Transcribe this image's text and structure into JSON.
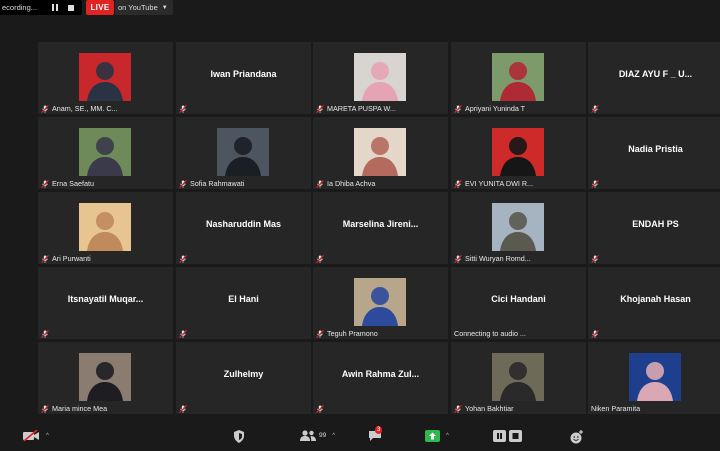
{
  "topbar": {
    "recording_text": "ecording...",
    "live_label": "LIVE",
    "youtube_label": "on YouTube"
  },
  "participants": [
    {
      "name": "Anam, SE., MM. C...",
      "has_video": true,
      "photo_bg": "#c8282c",
      "photo_fg": "#2a3344"
    },
    {
      "name": "",
      "display": "Iwan Priandana",
      "has_video": false
    },
    {
      "name": "MARETA PUSPA W...",
      "has_video": true,
      "photo_bg": "#d8d4cf",
      "photo_fg": "#e6a3b6"
    },
    {
      "name": "Apriyani Yuninda T",
      "has_video": true,
      "photo_bg": "#7d9a6a",
      "photo_fg": "#b02a35"
    },
    {
      "name": "",
      "display": "DIAZ AYU F _ U...",
      "has_video": false
    },
    {
      "name": "Erna Saefatu",
      "has_video": true,
      "photo_bg": "#6d8a58",
      "photo_fg": "#3a3a4a"
    },
    {
      "name": "Sofia Rahmawati",
      "has_video": true,
      "photo_bg": "#4d5660",
      "photo_fg": "#1a1f24"
    },
    {
      "name": "Ia Dhiba Achva",
      "has_video": true,
      "photo_bg": "#e4d6c8",
      "photo_fg": "#b46a5c"
    },
    {
      "name": "EVI YUNITA DWI R...",
      "has_video": true,
      "photo_bg": "#cf2a2a",
      "photo_fg": "#161616"
    },
    {
      "name": "",
      "display": "Nadia Pristia",
      "has_video": false
    },
    {
      "name": "Ari Purwanti",
      "has_video": true,
      "photo_bg": "#e8c590",
      "photo_fg": "#c08a5a"
    },
    {
      "name": "",
      "display": "Nasharuddin Mas",
      "has_video": false
    },
    {
      "name": "",
      "display": "Marselina  Jireni...",
      "has_video": false
    },
    {
      "name": "Sitti Wuryan Romd...",
      "has_video": true,
      "photo_bg": "#a6b4c2",
      "photo_fg": "#5a5a50"
    },
    {
      "name": "",
      "display": "ENDAH PS",
      "has_video": false
    },
    {
      "name": "",
      "display": "Itsnayatil  Muqar...",
      "has_video": false
    },
    {
      "name": "",
      "display": "El Hani",
      "has_video": false
    },
    {
      "name": "Teguh Pramono",
      "has_video": true,
      "photo_bg": "#b8a68a",
      "photo_fg": "#2e4a9c"
    },
    {
      "name": "Connecting to audio ...",
      "display": "Cici Handani",
      "has_video": false,
      "no_mute": true
    },
    {
      "name": "",
      "display": "Khojanah Hasan",
      "has_video": false
    },
    {
      "name": "Maria mince Mea",
      "has_video": true,
      "photo_bg": "#8a7c70",
      "photo_fg": "#1e1e22"
    },
    {
      "name": "",
      "display": "Zulhelmy",
      "has_video": false
    },
    {
      "name": "",
      "display": "Awin  Rahma  Zul...",
      "has_video": false
    },
    {
      "name": "Yohan Bakhtiar",
      "has_video": true,
      "photo_bg": "#6e6a58",
      "photo_fg": "#2a2a2a"
    },
    {
      "name": "Niken Paramita",
      "has_video": true,
      "photo_bg": "#1e3f8e",
      "photo_fg": "#d9a8b4",
      "no_mute": true
    }
  ],
  "bottombar": {
    "participants_count": "99",
    "chat_badge": "3"
  }
}
